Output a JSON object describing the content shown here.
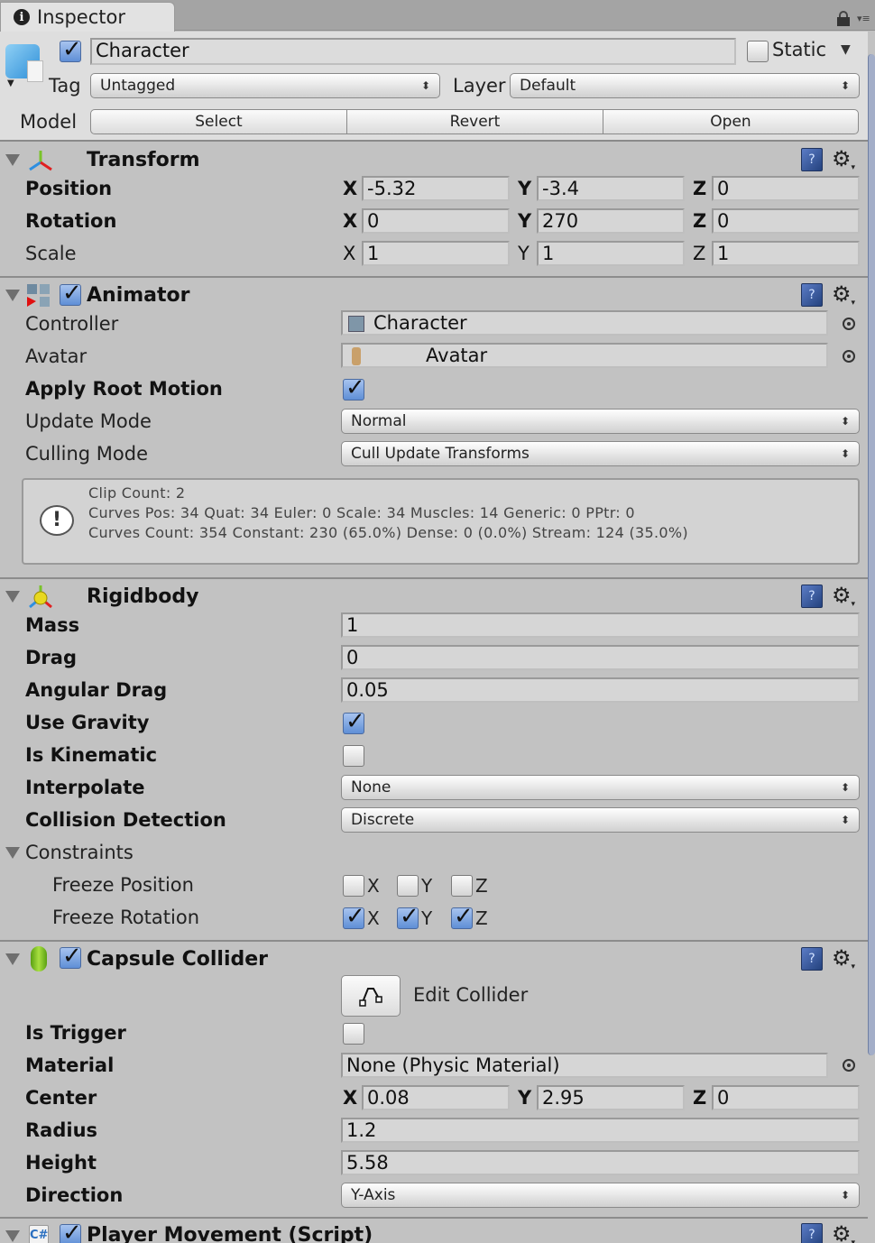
{
  "tab": {
    "title": "Inspector"
  },
  "header": {
    "active": true,
    "name": "Character",
    "static_label": "Static",
    "static_checked": false,
    "tag_label": "Tag",
    "tag_value": "Untagged",
    "layer_label": "Layer",
    "layer_value": "Default",
    "model_label": "Model",
    "model_buttons": [
      "Select",
      "Revert",
      "Open"
    ]
  },
  "transform": {
    "title": "Transform",
    "rows": [
      {
        "label": "Position",
        "x": "-5.32",
        "y": "-3.4",
        "z": "0"
      },
      {
        "label": "Rotation",
        "x": "0",
        "y": "270",
        "z": "0"
      },
      {
        "label": "Scale",
        "x": "1",
        "y": "1",
        "z": "1"
      }
    ]
  },
  "axes": {
    "x": "X",
    "y": "Y",
    "z": "Z"
  },
  "animator": {
    "title": "Animator",
    "enabled": true,
    "controller_label": "Controller",
    "controller_value": "Character",
    "avatar_label": "Avatar",
    "avatar_value": "Avatar",
    "apply_root_motion_label": "Apply Root Motion",
    "apply_root_motion": true,
    "update_mode_label": "Update Mode",
    "update_mode_value": "Normal",
    "culling_mode_label": "Culling Mode",
    "culling_mode_value": "Cull Update Transforms",
    "info_lines": [
      "Clip Count: 2",
      "Curves Pos: 34 Quat: 34 Euler: 0 Scale: 34 Muscles: 14 Generic: 0 PPtr: 0",
      "Curves Count: 354 Constant: 230 (65.0%) Dense: 0 (0.0%) Stream: 124 (35.0%)"
    ]
  },
  "rigidbody": {
    "title": "Rigidbody",
    "mass_label": "Mass",
    "mass": "1",
    "drag_label": "Drag",
    "drag": "0",
    "angular_drag_label": "Angular Drag",
    "angular_drag": "0.05",
    "use_gravity_label": "Use Gravity",
    "use_gravity": true,
    "is_kinematic_label": "Is Kinematic",
    "is_kinematic": false,
    "interpolate_label": "Interpolate",
    "interpolate": "None",
    "collision_detection_label": "Collision Detection",
    "collision_detection": "Discrete",
    "constraints_label": "Constraints",
    "freeze_position_label": "Freeze Position",
    "freeze_position": {
      "x": false,
      "y": false,
      "z": false
    },
    "freeze_rotation_label": "Freeze Rotation",
    "freeze_rotation": {
      "x": true,
      "y": true,
      "z": true
    }
  },
  "capsule_collider": {
    "title": "Capsule Collider",
    "enabled": true,
    "edit_collider_label": "Edit Collider",
    "is_trigger_label": "Is Trigger",
    "is_trigger": false,
    "material_label": "Material",
    "material": "None (Physic Material)",
    "center_label": "Center",
    "center": {
      "x": "0.08",
      "y": "2.95",
      "z": "0"
    },
    "radius_label": "Radius",
    "radius": "1.2",
    "height_label": "Height",
    "height": "5.58",
    "direction_label": "Direction",
    "direction": "Y-Axis"
  },
  "player_movement": {
    "title": "Player Movement (Script)",
    "enabled": true
  },
  "icons": {
    "help": "?",
    "gear": "⚙",
    "dropdown_arrows": "▴▾",
    "warning": "!"
  }
}
